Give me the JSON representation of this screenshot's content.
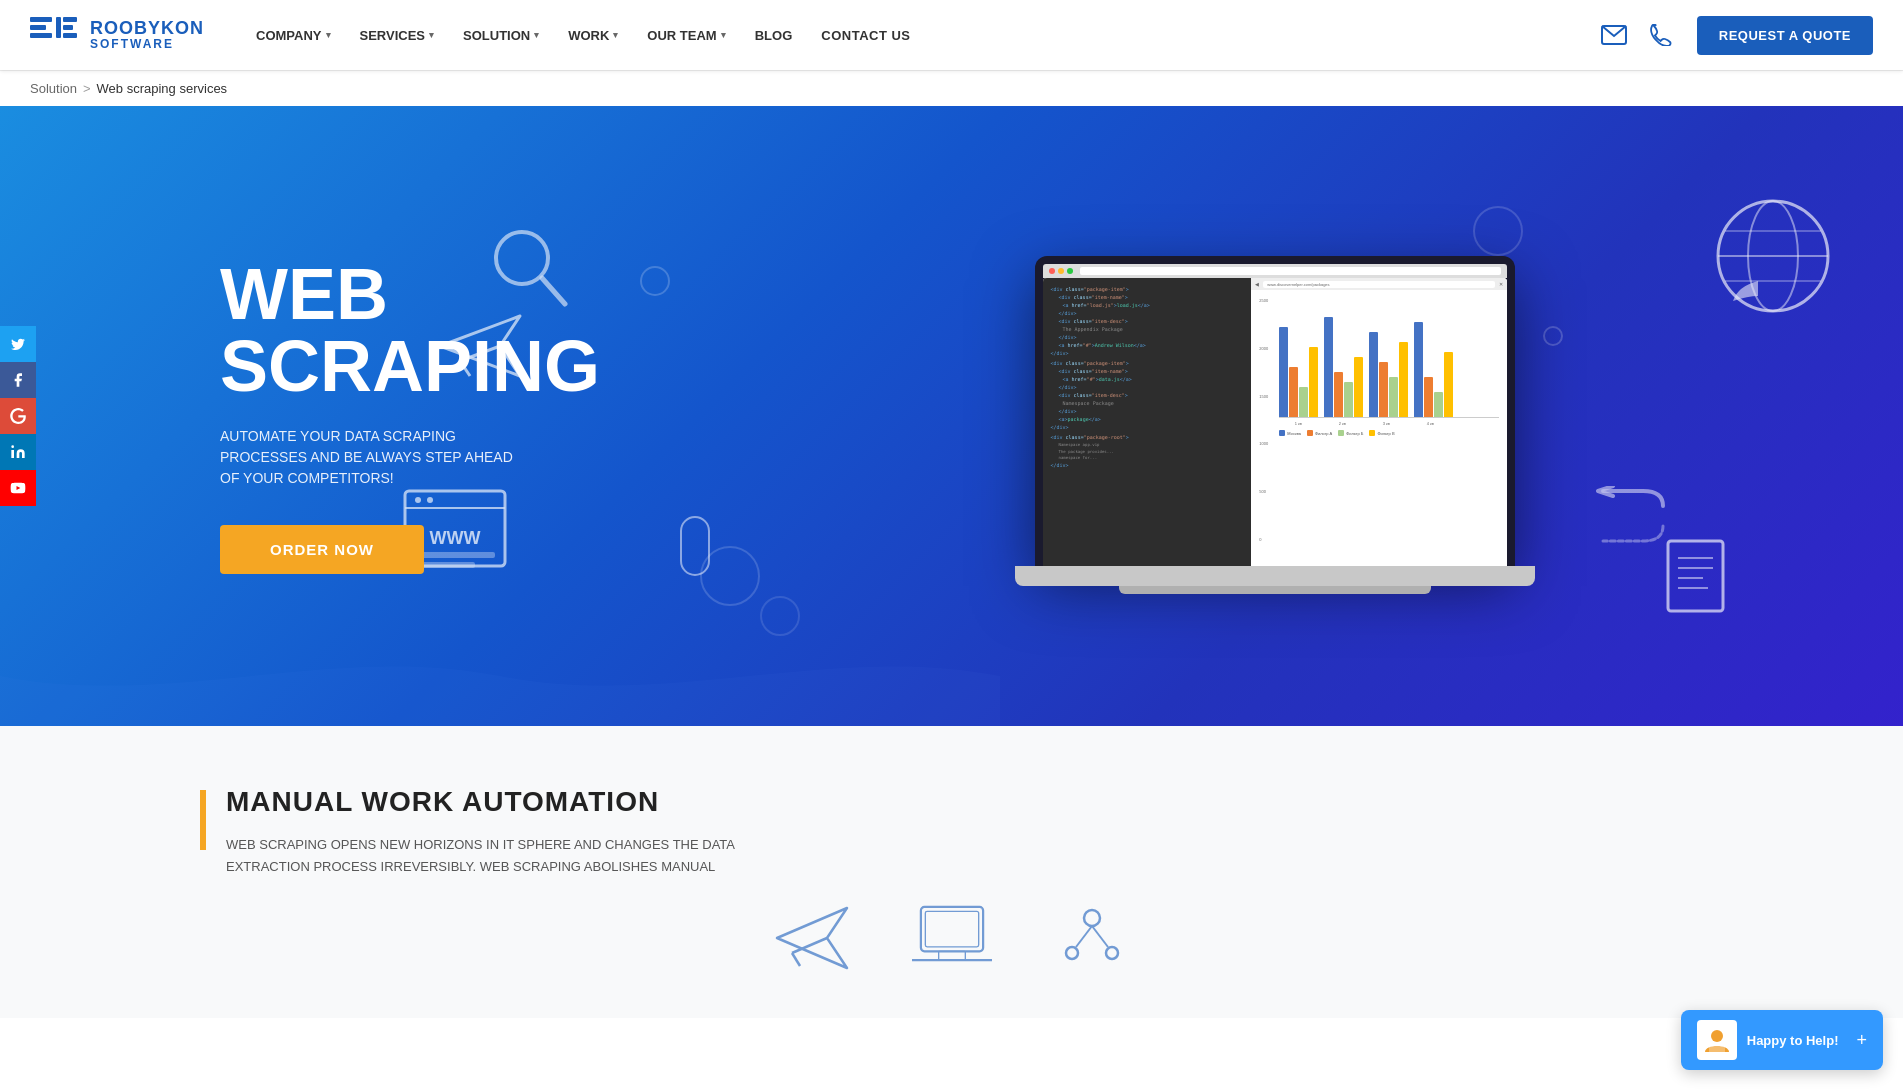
{
  "header": {
    "logo_brand": "ROOBYKON",
    "logo_sub": "SOFTWARE",
    "nav_items": [
      {
        "label": "COMPANY",
        "has_dropdown": true
      },
      {
        "label": "SERVICES",
        "has_dropdown": true
      },
      {
        "label": "SOLUTION",
        "has_dropdown": true
      },
      {
        "label": "WORK",
        "has_dropdown": true
      },
      {
        "label": "OUR TEAM",
        "has_dropdown": true
      },
      {
        "label": "BLOG",
        "has_dropdown": false
      },
      {
        "label": "CONTACT US",
        "has_dropdown": false
      }
    ],
    "request_btn": "REQUEST A QUOTE"
  },
  "breadcrumb": {
    "parent": "Solution",
    "separator": ">",
    "current": "Web scraping services"
  },
  "hero": {
    "title_line1": "WEB",
    "title_line2": "SCRAPING",
    "subtitle": "AUTOMATE YOUR DATA SCRAPING PROCESSES AND BE ALWAYS STEP AHEAD OF YOUR COMPETITORS!",
    "cta_button": "ORDER NOW"
  },
  "social": {
    "items": [
      {
        "name": "Twitter",
        "icon": "𝕏"
      },
      {
        "name": "Facebook",
        "icon": "f"
      },
      {
        "name": "Google+",
        "icon": "G+"
      },
      {
        "name": "LinkedIn",
        "icon": "in"
      },
      {
        "name": "YouTube",
        "icon": "▶"
      }
    ]
  },
  "below_section": {
    "title": "MANUAL WORK AUTOMATION",
    "text": "WEB SCRAPING OPENS NEW HORIZONS IN IT SPHERE AND CHANGES THE DATA EXTRACTION PROCESS IRREVERSIBLY. WEB SCRAPING ABOLISHES MANUAL"
  },
  "chat": {
    "label": "Happy to Help!",
    "plus_icon": "+"
  }
}
